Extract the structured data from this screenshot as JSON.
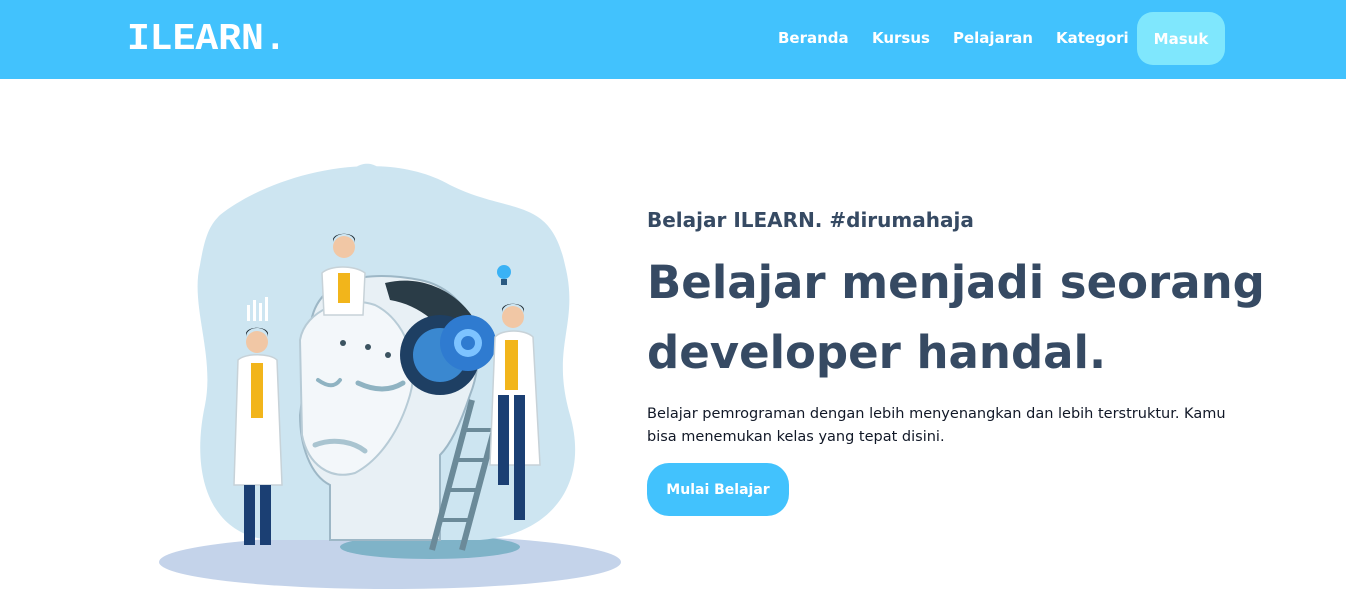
{
  "navbar": {
    "brand": "ILEARN.",
    "links": [
      "Beranda",
      "Kursus",
      "Pelajaran",
      "Kategori"
    ],
    "login_label": "Masuk",
    "bg_color": "#42c2fd",
    "login_bg_color": "#7fe7fd"
  },
  "hero": {
    "eyebrow": "Belajar ILEARN. #dirumahaja",
    "headline": "Belajar menjadi seorang developer handal.",
    "description": "Belajar pemrograman dengan lebih menyenangkan dan lebih terstruktur. Kamu bisa menemukan kelas yang tepat disini.",
    "cta_label": "Mulai Belajar",
    "text_color": "#364a63"
  }
}
